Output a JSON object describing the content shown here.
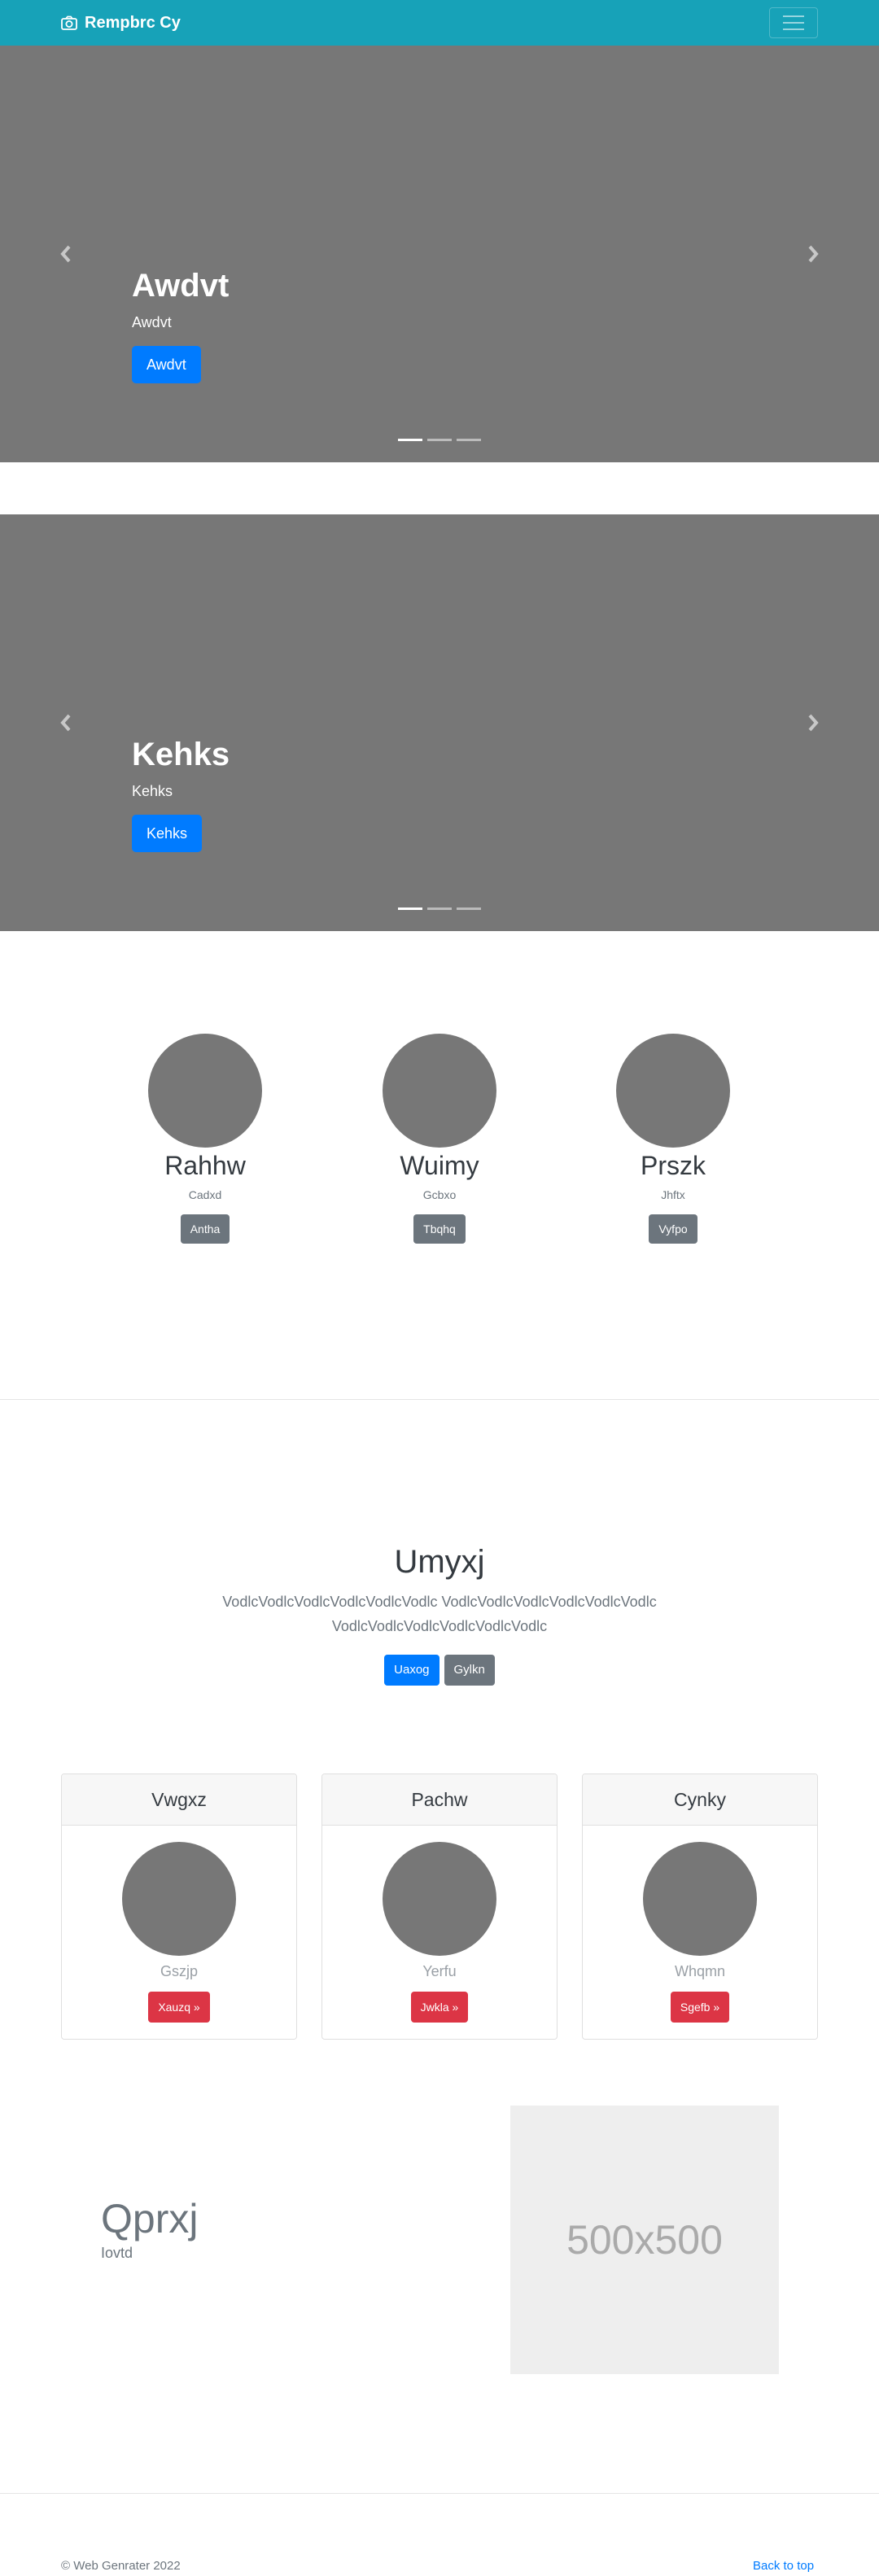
{
  "navbar": {
    "brand": "Rempbrc Cy",
    "brand_icon": "camera-icon",
    "toggler_icon": "menu-icon"
  },
  "carousels": [
    {
      "title": "Awdvt",
      "text": "Awdvt",
      "button": "Awdvt"
    },
    {
      "title": "Kehks",
      "text": "Kehks",
      "button": "Kehks"
    }
  ],
  "circles": [
    {
      "title": "Rahhw",
      "text": "Cadxd",
      "button": "Antha"
    },
    {
      "title": "Wuimy",
      "text": "Gcbxo",
      "button": "Tbqhq"
    },
    {
      "title": "Prszk",
      "text": "Jhftx",
      "button": "Vyfpo"
    }
  ],
  "jumbotron": {
    "title": "Umyxj",
    "text": "VodlcVodlcVodlcVodlcVodlcVodlc VodlcVodlcVodlcVodlcVodlcVodlc VodlcVodlcVodlcVodlcVodlcVodlc",
    "primary_button": "Uaxog",
    "secondary_button": "Gylkn"
  },
  "cards": [
    {
      "header": "Vwgxz",
      "text": "Gszjp",
      "button": "Xauzq »"
    },
    {
      "header": "Pachw",
      "text": "Yerfu",
      "button": "Jwkla »"
    },
    {
      "header": "Cynky",
      "text": "Whqmn",
      "button": "Sgefb »"
    }
  ],
  "featurette": {
    "title": "Qprxj",
    "text": "Iovtd",
    "image_label": "500x500"
  },
  "footer": {
    "copyright": "© Web Genrater 2022",
    "back_to_top": "Back to top"
  }
}
